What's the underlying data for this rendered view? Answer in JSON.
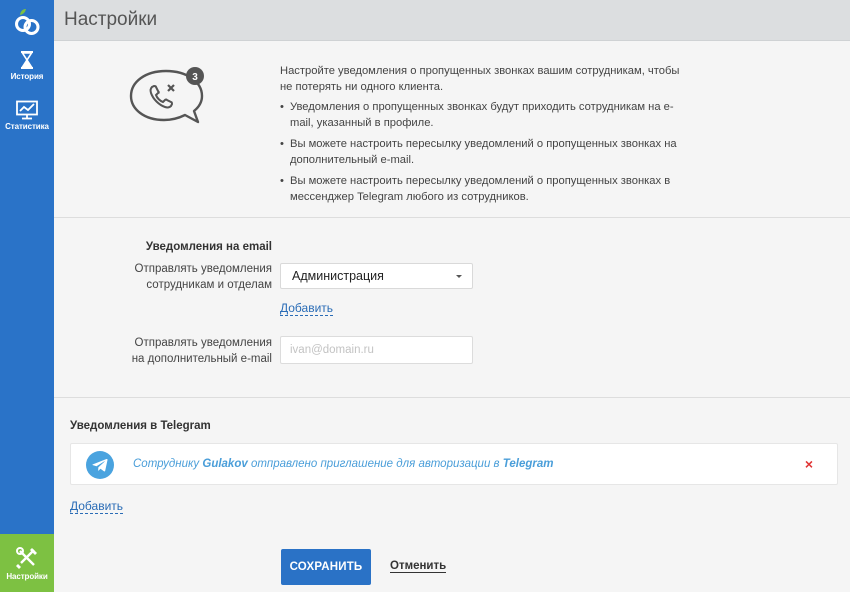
{
  "sidebar": {
    "items": [
      {
        "label": "История",
        "icon": "hourglass-icon"
      },
      {
        "label": "Статистика",
        "icon": "chart-monitor-icon"
      },
      {
        "label": "Настройки",
        "icon": "tools-icon",
        "active": true
      }
    ],
    "colors": {
      "bg": "#2a73c8",
      "active": "#7dc142"
    }
  },
  "header": {
    "title": "Настройки"
  },
  "intro": {
    "badge_count": "3",
    "lead": "Настройте уведомления о пропущенных звонках вашим сотрудникам, чтобы не потерять ни одного клиента.",
    "bullets": [
      "Уведомления о пропущенных звонках будут приходить сотрудникам на e-mail, указанный в профиле.",
      "Вы можете настроить пересылку уведомлений о пропущенных звонках на дополнительный e-mail.",
      "Вы можете настроить пересылку уведомлений о пропущенных звонках в мессенджер Telegram любого из сотрудников."
    ]
  },
  "email": {
    "title": "Уведомления на email",
    "depts_label_1": "Отправлять уведомления",
    "depts_label_2": "сотрудникам и отделам",
    "depts_selected": "Администрация",
    "add_label": "Добавить",
    "extra_label_1": "Отправлять уведомления",
    "extra_label_2": "на дополнительный e-mail",
    "extra_placeholder": "ivan@domain.ru",
    "extra_value": ""
  },
  "telegram": {
    "title": "Уведомления в Telegram",
    "msg_prefix": "Сотруднику ",
    "msg_user": "Gulakov",
    "msg_middle": " отправлено приглашение для авторизации в ",
    "msg_service": "Telegram",
    "close_glyph": "×",
    "add_label": "Добавить"
  },
  "actions": {
    "save_label": "СОХРАНИТЬ",
    "cancel_label": "Отменить",
    "accent": "#2a72c6"
  }
}
